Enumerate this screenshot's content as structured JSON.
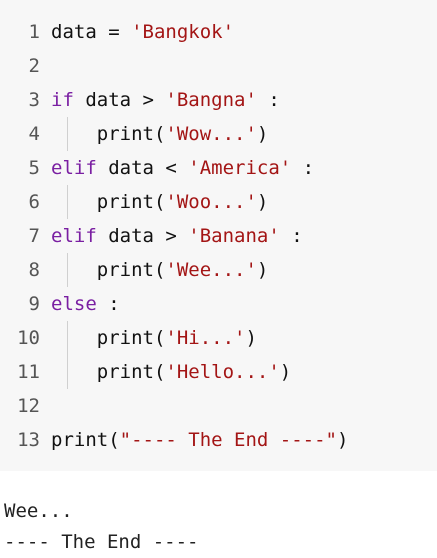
{
  "code_lines": [
    {
      "num": "1",
      "parts": [
        {
          "t": "txt",
          "v": "data = "
        },
        {
          "t": "str",
          "v": "'Bangkok'"
        }
      ]
    },
    {
      "num": "2",
      "parts": []
    },
    {
      "num": "3",
      "parts": [
        {
          "t": "kw",
          "v": "if"
        },
        {
          "t": "txt",
          "v": " data > "
        },
        {
          "t": "str",
          "v": "'Bangna'"
        },
        {
          "t": "txt",
          "v": " :"
        }
      ]
    },
    {
      "num": "4",
      "indent": true,
      "parts": [
        {
          "t": "txt",
          "v": "    print("
        },
        {
          "t": "str",
          "v": "'Wow...'"
        },
        {
          "t": "txt",
          "v": ")"
        }
      ]
    },
    {
      "num": "5",
      "parts": [
        {
          "t": "kw",
          "v": "elif"
        },
        {
          "t": "txt",
          "v": " data < "
        },
        {
          "t": "str",
          "v": "'America'"
        },
        {
          "t": "txt",
          "v": " :"
        }
      ]
    },
    {
      "num": "6",
      "indent": true,
      "parts": [
        {
          "t": "txt",
          "v": "    print("
        },
        {
          "t": "str",
          "v": "'Woo...'"
        },
        {
          "t": "txt",
          "v": ")"
        }
      ]
    },
    {
      "num": "7",
      "parts": [
        {
          "t": "kw",
          "v": "elif"
        },
        {
          "t": "txt",
          "v": " data > "
        },
        {
          "t": "str",
          "v": "'Banana'"
        },
        {
          "t": "txt",
          "v": " :"
        }
      ]
    },
    {
      "num": "8",
      "indent": true,
      "parts": [
        {
          "t": "txt",
          "v": "    print("
        },
        {
          "t": "str",
          "v": "'Wee...'"
        },
        {
          "t": "txt",
          "v": ")"
        }
      ]
    },
    {
      "num": "9",
      "parts": [
        {
          "t": "kw",
          "v": "else"
        },
        {
          "t": "txt",
          "v": " :"
        }
      ]
    },
    {
      "num": "10",
      "indent": true,
      "parts": [
        {
          "t": "txt",
          "v": "    print("
        },
        {
          "t": "str",
          "v": "'Hi...'"
        },
        {
          "t": "txt",
          "v": ")"
        }
      ]
    },
    {
      "num": "11",
      "indent": true,
      "parts": [
        {
          "t": "txt",
          "v": "    print("
        },
        {
          "t": "str",
          "v": "'Hello...'"
        },
        {
          "t": "txt",
          "v": ")"
        }
      ]
    },
    {
      "num": "12",
      "parts": []
    },
    {
      "num": "13",
      "parts": [
        {
          "t": "txt",
          "v": "print("
        },
        {
          "t": "str",
          "v": "\"---- The End ----\""
        },
        {
          "t": "txt",
          "v": ")"
        }
      ]
    }
  ],
  "output_lines": [
    "Wee...",
    "---- The End ----"
  ],
  "colors": {
    "keyword": "#7a1fa2",
    "string": "#a31515",
    "editor_bg": "#f7f7f7"
  }
}
